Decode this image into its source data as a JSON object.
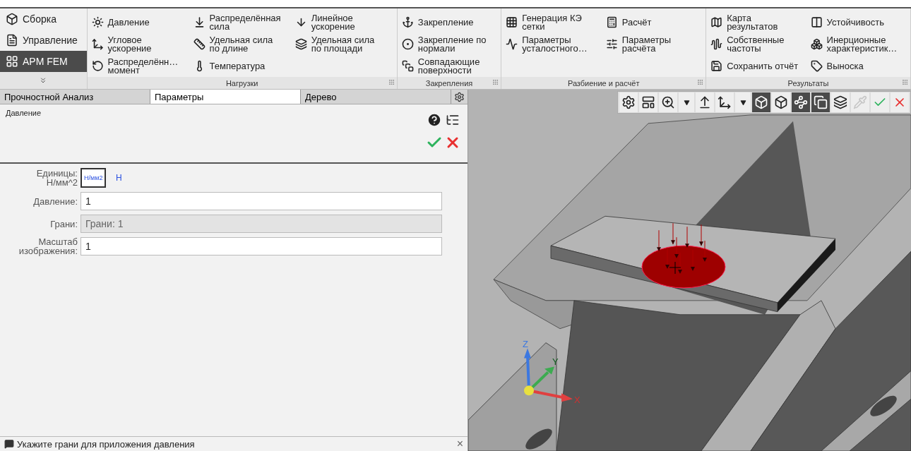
{
  "ribbon": {
    "modes": [
      {
        "label": "Сборка",
        "selected": false
      },
      {
        "label": "Управление",
        "selected": false
      },
      {
        "label": "APM FEM",
        "selected": true
      }
    ],
    "groups": [
      {
        "title": "Нагрузки",
        "columns": [
          [
            {
              "label": "Давление"
            },
            {
              "label": "Угловое\nускорение"
            },
            {
              "label": "Распределённ…\nмомент"
            }
          ],
          [
            {
              "label": "Распределённая\nсила"
            },
            {
              "label": "Удельная сила\nпо длине"
            },
            {
              "label": "Температура"
            }
          ],
          [
            {
              "label": "Линейное\nускорение"
            },
            {
              "label": "Удельная сила\nпо площади"
            }
          ]
        ]
      },
      {
        "title": "Закрепления",
        "columns": [
          [
            {
              "label": "Закрепление"
            },
            {
              "label": "Закрепление по\nнормали"
            },
            {
              "label": "Совпадающие\nповерхности"
            }
          ]
        ]
      },
      {
        "title": "Разбиение и расчёт",
        "columns": [
          [
            {
              "label": "Генерация КЭ\nсетки"
            },
            {
              "label": "Параметры\nусталостного…"
            }
          ],
          [
            {
              "label": "Расчёт"
            },
            {
              "label": "Параметры\nрасчёта"
            }
          ]
        ]
      },
      {
        "title": "Результаты",
        "columns": [
          [
            {
              "label": "Карта\nрезультатов"
            },
            {
              "label": "Собственные\nчастоты"
            },
            {
              "label": "Сохранить отчёт"
            }
          ],
          [
            {
              "label": "Устойчивость"
            },
            {
              "label": "Инерционные\nхарактеристик…"
            },
            {
              "label": "Выноска"
            }
          ]
        ]
      }
    ]
  },
  "panel": {
    "tabs": [
      {
        "label": "Прочностной Анализ",
        "selected": false
      },
      {
        "label": "Параметры",
        "selected": true
      },
      {
        "label": "Дерево",
        "selected": false
      }
    ],
    "title": "Давление",
    "units": {
      "label": "Единицы:\nН/мм^2",
      "options": [
        {
          "label": "Н/мм2",
          "selected": true
        },
        {
          "label": "Н",
          "selected": false
        }
      ]
    },
    "fields": [
      {
        "label": "Давление:",
        "value": "1",
        "disabled": false
      },
      {
        "label": "Грани:",
        "value": "Грани: 1",
        "disabled": true
      },
      {
        "label": "Масштаб\nизображения:",
        "value": "1",
        "disabled": false
      }
    ]
  },
  "status_bar": {
    "message": "Укажите грани для приложения давления",
    "close": "×"
  },
  "viewport": {
    "toolbar": [
      {
        "selected": false,
        "disabled": false
      },
      {
        "selected": false,
        "disabled": false
      },
      {
        "selected": false,
        "disabled": false
      },
      {
        "selected": false,
        "disabled": false
      },
      {
        "selected": false,
        "disabled": false
      },
      {
        "selected": false,
        "disabled": false
      },
      {
        "selected": false,
        "disabled": false
      },
      {
        "selected": true,
        "disabled": false
      },
      {
        "selected": false,
        "disabled": false
      },
      {
        "selected": true,
        "disabled": false
      },
      {
        "selected": true,
        "disabled": false
      },
      {
        "selected": false,
        "disabled": false
      },
      {
        "selected": false,
        "disabled": true
      },
      {
        "selected": false,
        "disabled": false
      },
      {
        "selected": false,
        "disabled": false
      }
    ],
    "axes": [
      "X",
      "Y",
      "Z"
    ]
  }
}
